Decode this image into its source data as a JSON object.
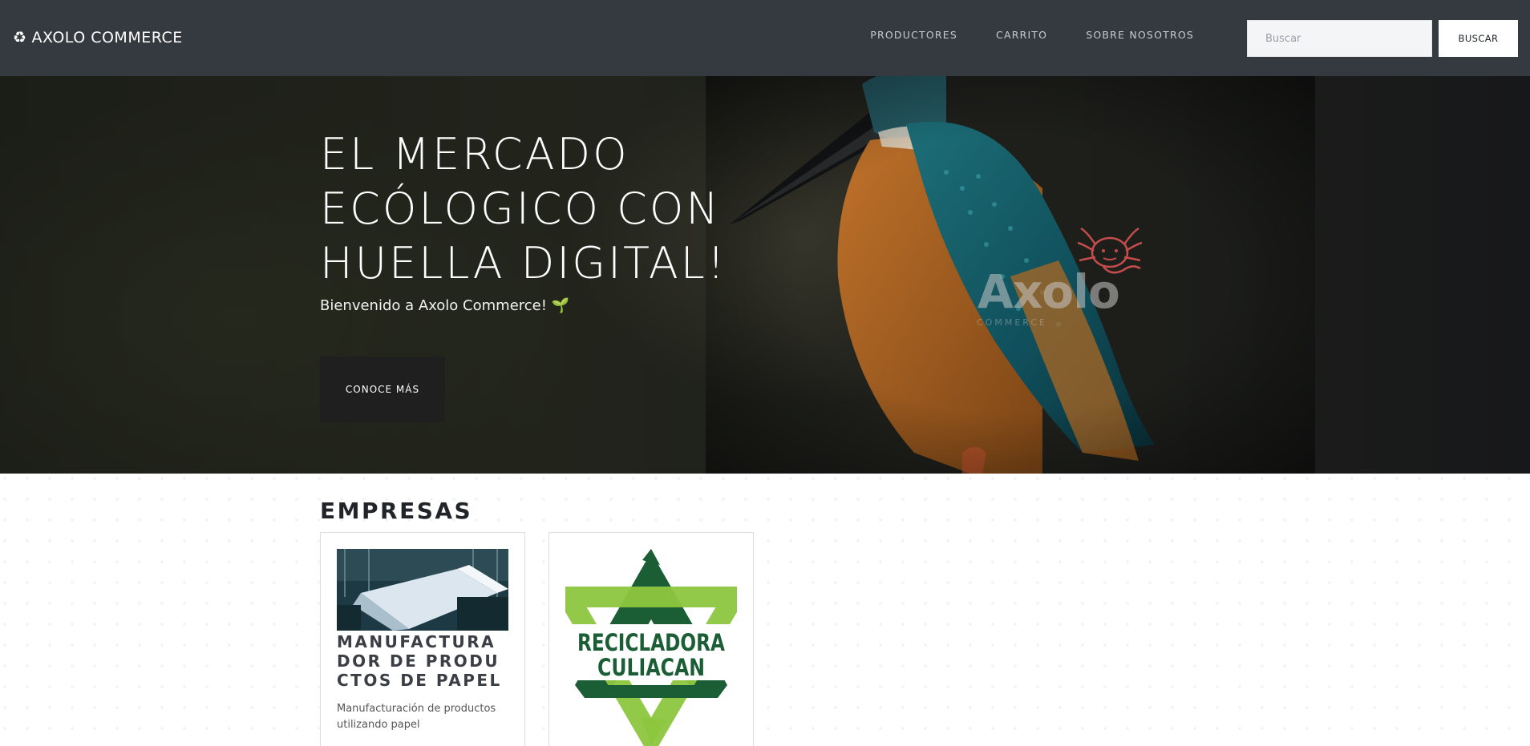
{
  "navbar": {
    "brand_icon": "recycle-icon",
    "brand": "AXOLO COMMERCE",
    "links": [
      "PRODUCTORES",
      "CARRITO",
      "SOBRE NOSOTROS"
    ],
    "search_placeholder": "Buscar",
    "search_button": "BUSCAR"
  },
  "hero": {
    "title": "EL MERCADO ECÓLOGICO CON HUELLA DIGITAL!",
    "subtitle": "Bienvenido a Axolo Commerce! 🌱",
    "button": "CONOCE MÁS",
    "watermark_name": "Axolo",
    "watermark_sub": "COMMERCE"
  },
  "main": {
    "section_title": "EMPRESAS",
    "companies": [
      {
        "title": "MANUFACTURADOR DE PRODUCTOS DE PAPEL",
        "description": "Manufacturación de productos utilizando papel"
      },
      {
        "logo_line1": "RECICLADORA",
        "logo_line2": "CULIACAN"
      }
    ]
  },
  "colors": {
    "navbar_bg": "#343a40",
    "hero_button_bg": "#1f1f1f",
    "logo_dark_green": "#1b5e35",
    "logo_light_green": "#8dc63f"
  }
}
